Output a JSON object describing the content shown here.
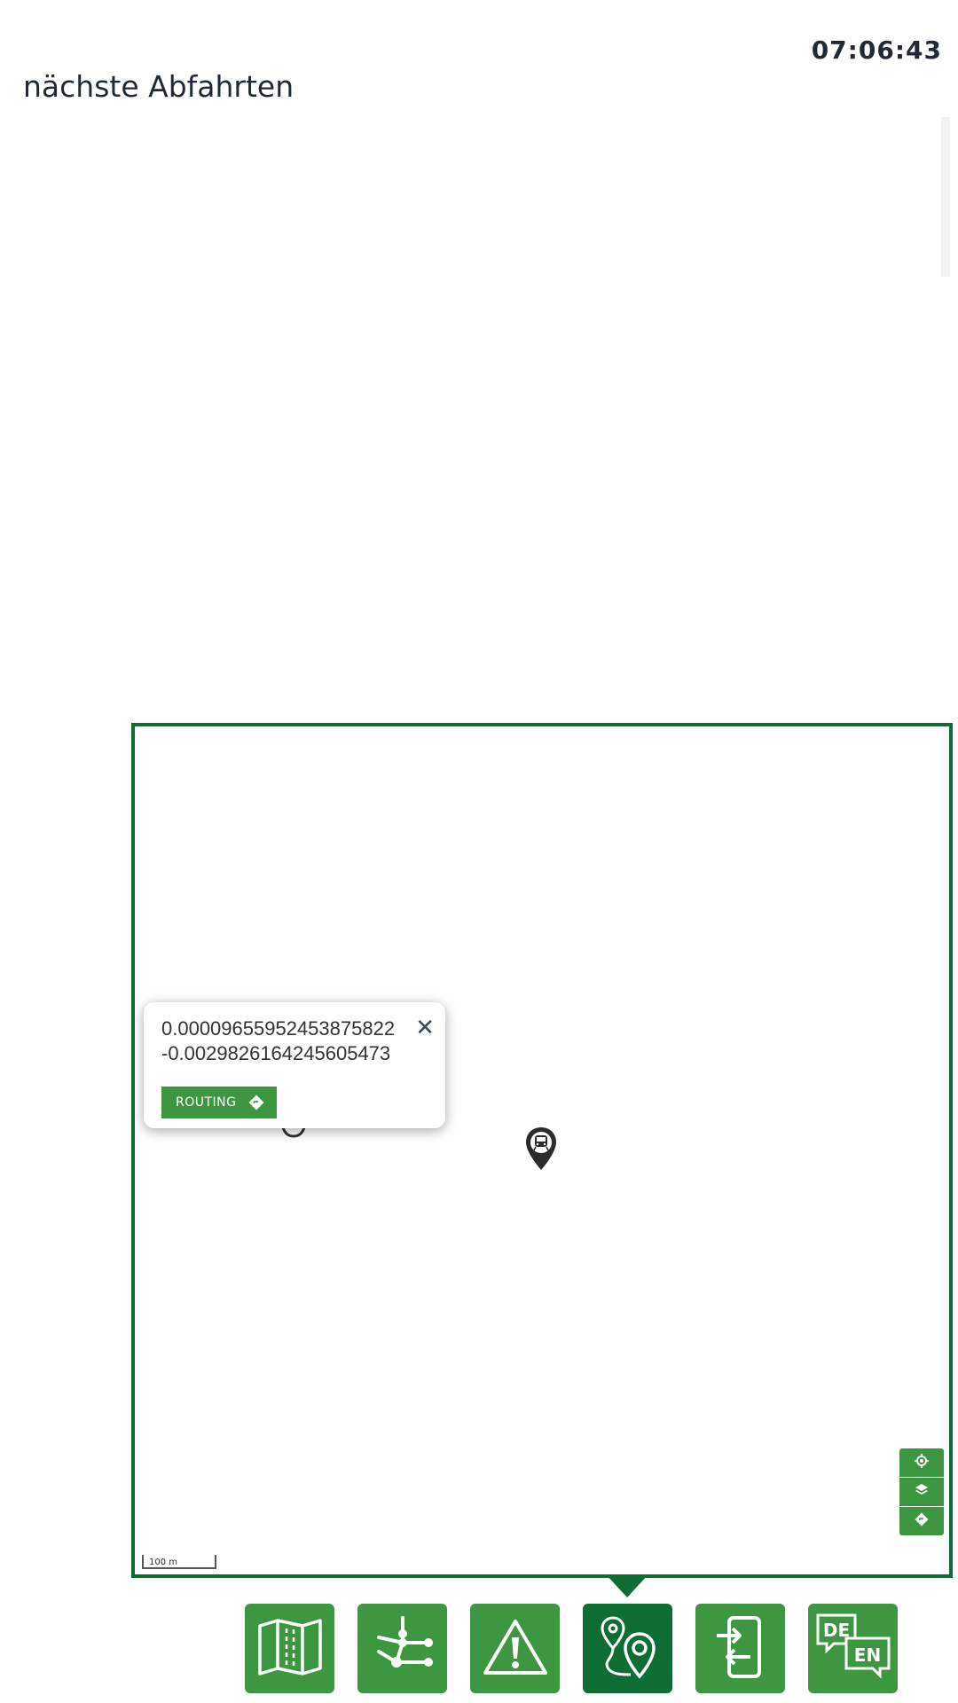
{
  "header": {
    "clock": "07:06:43",
    "section_title": "nächste Abfahrten"
  },
  "map": {
    "popup": {
      "coord_lat": "0.00009655952453875822",
      "coord_lon": "-0.0029826164245605473",
      "close_icon": "close-icon",
      "routing_label": "ROUTING",
      "routing_icon": "route-diamond-icon"
    },
    "markers": [
      {
        "name": "station-marker",
        "icon": "tram-pin-icon"
      }
    ],
    "controls": [
      {
        "name": "locate-button",
        "icon": "crosshair-icon"
      },
      {
        "name": "layers-button",
        "icon": "layers-icon"
      },
      {
        "name": "route-button",
        "icon": "route-diamond-icon"
      }
    ],
    "scale": "100 m"
  },
  "bottom_nav": {
    "items": [
      {
        "name": "map",
        "icon": "folded-map-icon",
        "active": false
      },
      {
        "name": "network",
        "icon": "transit-network-icon",
        "active": false
      },
      {
        "name": "disruptions",
        "icon": "warning-icon",
        "active": false
      },
      {
        "name": "route-planner",
        "icon": "route-pins-icon",
        "active": true
      },
      {
        "name": "exit",
        "icon": "phone-exit-icon",
        "active": false
      },
      {
        "name": "language",
        "icon": "de-en-icon",
        "active": false
      }
    ],
    "language_de": "DE",
    "language_en": "EN"
  },
  "colors": {
    "primary_green": "#3d9640",
    "dark_green": "#0d6e33",
    "text_dark": "#1f2a36"
  }
}
